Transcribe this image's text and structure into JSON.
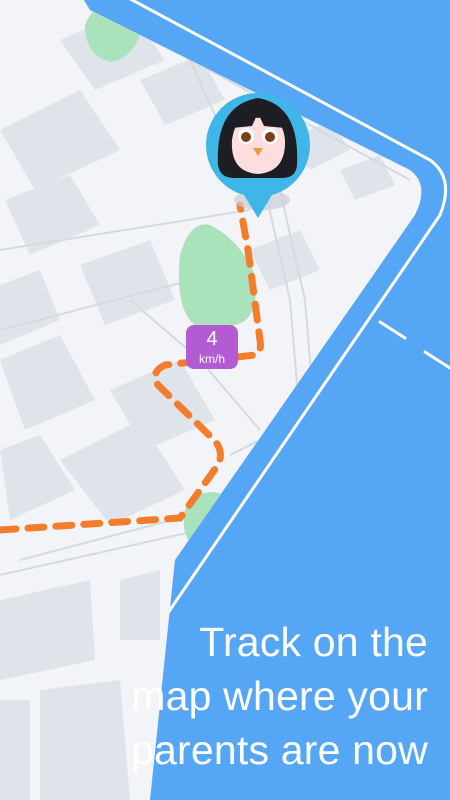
{
  "colors": {
    "background": "#55a6f5",
    "map_base": "#f3f4f7",
    "block": "#dfe3ea",
    "road_line": "#d5d9e0",
    "park": "#a9e2bb",
    "route": "#f47d2b",
    "pin": "#3fb6e8",
    "speed_badge": "#b35bd3",
    "caption_text": "#ffffff"
  },
  "speed_badge": {
    "value": "4",
    "unit": "km/h"
  },
  "avatar": {
    "icon": "girl-avatar-icon"
  },
  "caption": {
    "line1": "Track on the",
    "line2": "map where your",
    "line3": "parents are now"
  }
}
